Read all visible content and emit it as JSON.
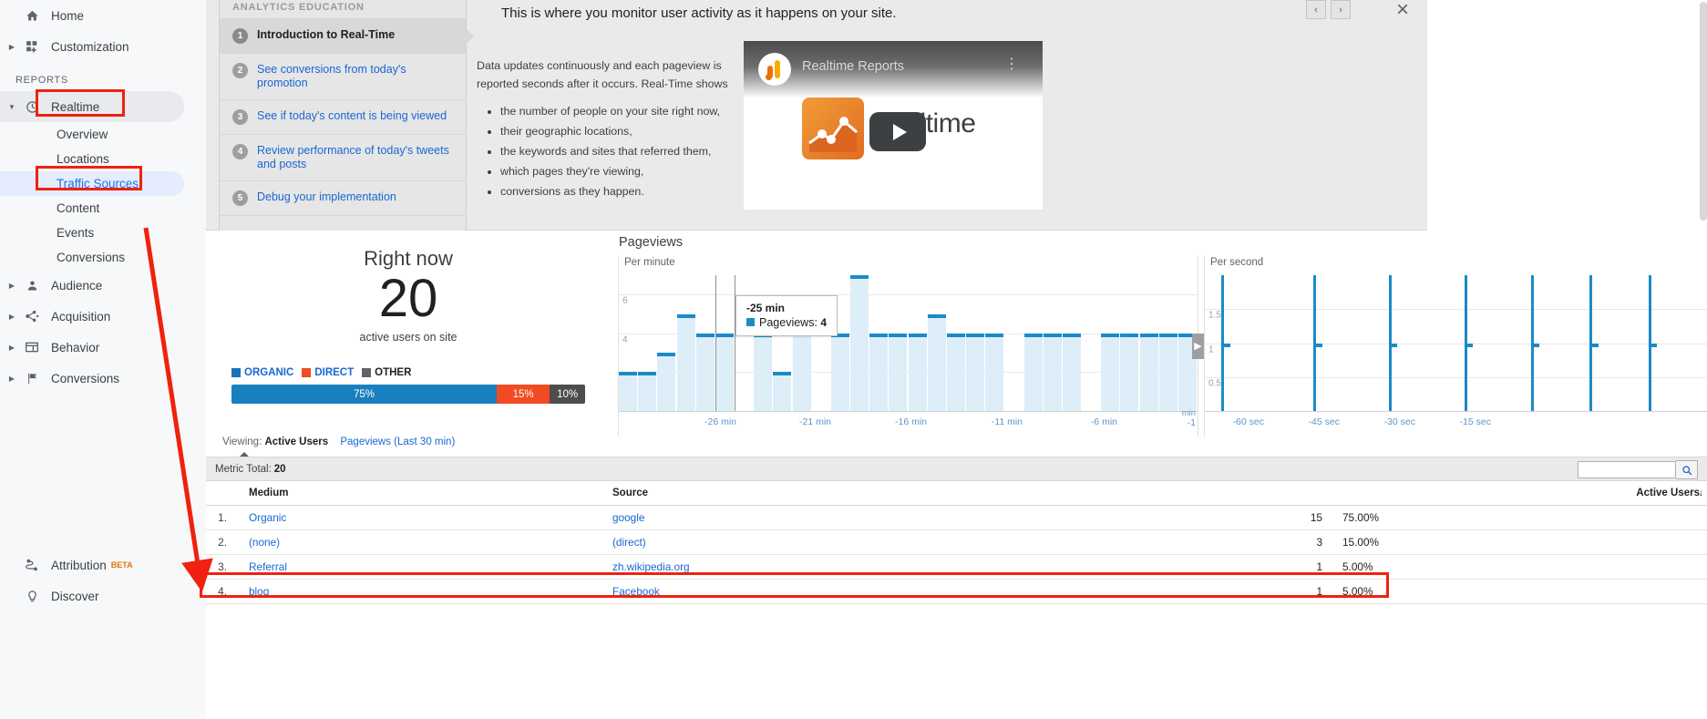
{
  "sidebar": {
    "reports_label": "REPORTS",
    "items": [
      {
        "label": "Home",
        "icon": "home-icon",
        "caret": false,
        "type": "top"
      },
      {
        "label": "Customization",
        "icon": "customization-icon",
        "caret": true,
        "type": "top"
      },
      {
        "label": "Realtime",
        "icon": "clock-icon",
        "caret": true,
        "type": "top",
        "state": "selected"
      },
      {
        "label": "Overview",
        "type": "sub"
      },
      {
        "label": "Locations",
        "type": "sub"
      },
      {
        "label": "Traffic Sources",
        "type": "sub",
        "state": "active"
      },
      {
        "label": "Content",
        "type": "sub"
      },
      {
        "label": "Events",
        "type": "sub"
      },
      {
        "label": "Conversions",
        "type": "sub"
      },
      {
        "label": "Audience",
        "icon": "person-icon",
        "caret": true,
        "type": "top"
      },
      {
        "label": "Acquisition",
        "icon": "acquisition-icon",
        "caret": true,
        "type": "top"
      },
      {
        "label": "Behavior",
        "icon": "behavior-icon",
        "caret": true,
        "type": "top"
      },
      {
        "label": "Conversions",
        "icon": "flag-icon",
        "caret": true,
        "type": "top"
      }
    ],
    "footer": [
      {
        "label": "Attribution",
        "badge": "BETA",
        "icon": "attribution-icon"
      },
      {
        "label": "Discover",
        "icon": "bulb-icon"
      }
    ]
  },
  "education": {
    "header": "ANALYTICS EDUCATION",
    "steps": [
      {
        "num": "1",
        "label": "Introduction to Real-Time",
        "current": true
      },
      {
        "num": "2",
        "label": "See conversions from today's promotion",
        "current": false
      },
      {
        "num": "3",
        "label": "See if today's content is being viewed",
        "current": false
      },
      {
        "num": "4",
        "label": "Review performance of today's tweets and posts",
        "current": false
      },
      {
        "num": "5",
        "label": "Debug your implementation",
        "current": false
      }
    ],
    "headline": "This is where you monitor user activity as it happens on your site.",
    "paragraph": "Data updates continuously and each pageview is reported seconds after it occurs. Real-Time shows",
    "bullets": [
      "the number of people on your site right now,",
      "their geographic locations,",
      "the keywords and sites that referred them,",
      "which pages they're viewing,",
      "conversions as they happen."
    ],
    "video_title": "Realtime Reports",
    "video_word": "Realtime",
    "prev_label": "‹",
    "next_label": "›",
    "close_label": "×"
  },
  "right_now": {
    "title": "Right now",
    "count": "20",
    "subtitle": "active users on site",
    "legend": [
      {
        "label": "ORGANIC",
        "color": "#1a73b7"
      },
      {
        "label": "DIRECT",
        "color": "#f04b23"
      },
      {
        "label": "OTHER",
        "color": "#5f6368"
      }
    ],
    "segments": [
      {
        "label": "75%",
        "value": 75,
        "color": "#1a7fbe"
      },
      {
        "label": "15%",
        "value": 15,
        "color": "#f04b23"
      },
      {
        "label": "10%",
        "value": 10,
        "color": "#4d4d4d"
      }
    ]
  },
  "chart_data": [
    {
      "type": "bar",
      "title": "Pageviews",
      "subtitle": "Per minute",
      "xlabel": "min",
      "ylabel": "",
      "ylim": [
        0,
        7
      ],
      "yticks": [
        "2",
        "4",
        "6"
      ],
      "xticks": [
        "-26 min",
        "-21 min",
        "-16 min",
        "-11 min",
        "-6 min",
        "-1"
      ],
      "axis_unit": "min",
      "bar_color": "#1a8bc7",
      "fill_color": "#ddeef8",
      "categories": [
        "-30",
        "-29",
        "-28",
        "-27",
        "-26",
        "-25",
        "-24",
        "-23",
        "-22",
        "-21",
        "-20",
        "-19",
        "-18",
        "-17",
        "-16",
        "-15",
        "-14",
        "-13",
        "-12",
        "-11",
        "-10",
        "-9",
        "-8",
        "-7",
        "-6",
        "-5",
        "-4",
        "-3",
        "-2",
        "-1"
      ],
      "values": [
        2,
        2,
        3,
        5,
        4,
        4,
        0,
        4,
        2,
        5,
        0,
        4,
        7,
        4,
        4,
        4,
        5,
        4,
        4,
        4,
        0,
        4,
        4,
        4,
        0,
        4,
        4,
        4,
        4,
        4
      ],
      "tooltip": {
        "title": "-25 min",
        "series": "Pageviews",
        "value": "4"
      }
    },
    {
      "type": "bar",
      "title": "Pageviews",
      "subtitle": "Per second",
      "ylim": [
        0,
        2
      ],
      "yticks": [
        "0.5",
        "1",
        "1.5"
      ],
      "xticks": [
        "-60 sec",
        "-45 sec",
        "-30 sec",
        "-15 sec"
      ],
      "bar_color": "#1a8bc7",
      "categories": [
        "-60",
        "-59",
        "-58",
        "-57",
        "-56",
        "-55",
        "-54",
        "-53",
        "-52",
        "-51",
        "-50",
        "-49",
        "-48",
        "-47",
        "-46",
        "-45",
        "-44",
        "-43",
        "-42",
        "-41",
        "-40",
        "-39",
        "-38",
        "-37",
        "-36",
        "-35",
        "-34",
        "-33",
        "-32",
        "-31",
        "-30",
        "-29",
        "-28",
        "-27",
        "-26",
        "-25",
        "-24",
        "-23",
        "-22",
        "-21",
        "-20",
        "-19",
        "-18",
        "-17",
        "-16",
        "-15",
        "-14",
        "-13",
        "-12",
        "-11",
        "-10",
        "-9",
        "-8",
        "-7",
        "-6",
        "-5",
        "-4",
        "-3",
        "-2",
        "-1"
      ],
      "values": [
        0,
        0,
        1,
        0,
        0,
        0,
        0,
        0,
        0,
        0,
        0,
        0,
        0,
        1,
        0,
        0,
        0,
        0,
        0,
        0,
        0,
        0,
        1,
        0,
        0,
        0,
        0,
        0,
        0,
        0,
        0,
        1,
        0,
        0,
        0,
        0,
        0,
        0,
        0,
        1,
        0,
        0,
        0,
        0,
        0,
        0,
        1,
        0,
        0,
        0,
        0,
        0,
        0,
        1,
        0,
        0,
        0,
        0,
        0,
        0
      ]
    }
  ],
  "viewing": {
    "label": "Viewing:",
    "active_tab": "Active Users",
    "other_tab": "Pageviews (Last 30 min)"
  },
  "table": {
    "metric_total_label": "Metric Total:",
    "metric_total_value": "20",
    "search_placeholder": "",
    "search_value": "",
    "columns": [
      "",
      "Medium",
      "Source",
      "Active Users",
      ""
    ],
    "header_active_users": "Active Users",
    "rows": [
      {
        "index": "1.",
        "medium": "Organic",
        "source": "google",
        "users": "15",
        "percent": "75.00%"
      },
      {
        "index": "2.",
        "medium": "(none)",
        "source": "(direct)",
        "users": "3",
        "percent": "15.00%"
      },
      {
        "index": "3.",
        "medium": "Referral",
        "source": "zh.wikipedia.org",
        "users": "1",
        "percent": "5.00%"
      },
      {
        "index": "4.",
        "medium": "blog",
        "source": "Facebook",
        "users": "1",
        "percent": "5.00%"
      }
    ]
  },
  "annotations": {
    "accent": "#f0210e"
  }
}
